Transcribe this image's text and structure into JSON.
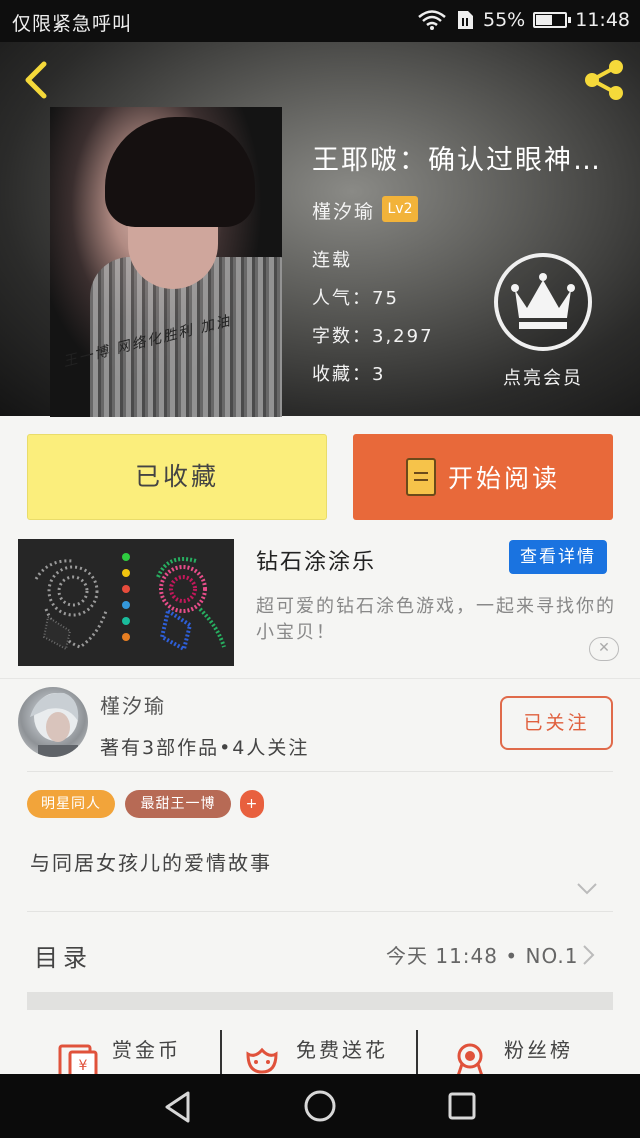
{
  "status_bar": {
    "carrier": "仅限紧急呼叫",
    "battery": "55%",
    "time": "11:48",
    "battery_level": 0.55
  },
  "header": {
    "title": "王耶啵：确认过眼神…",
    "author": "槿汐瑜",
    "level": "Lv2",
    "status": "连载",
    "popularity": "人气：75",
    "word_count": "字数：3,297",
    "favorites": "收藏：3",
    "vip_label": "点亮会员",
    "cover_signature": "王一博  网络化胜利  加油"
  },
  "actions_top": {
    "collected": "已收藏",
    "read": "开始阅读"
  },
  "ad": {
    "title": "钻石涂涂乐",
    "detail_button": "查看详情",
    "description": "超可爱的钻石涂色游戏，一起来寻找你的小宝贝！",
    "close": "✕"
  },
  "author_panel": {
    "name": "槿汐瑜",
    "stats": "著有3部作品•4人关注",
    "follow": "已关注"
  },
  "tags": [
    "明星同人",
    "最甜王一博"
  ],
  "tag_add": "+",
  "summary": "与同居女孩儿的爱情故事",
  "toc": {
    "label": "目录",
    "info": "今天  11:48 • NO.1"
  },
  "bottom_actions": [
    "赏金币",
    "免费送花",
    "粉丝榜"
  ],
  "colors": {
    "accent_orange": "#e8693a",
    "collected_yellow": "#fbee7c",
    "detail_blue": "#1a73e0",
    "level_badge": "#f2b33a"
  }
}
